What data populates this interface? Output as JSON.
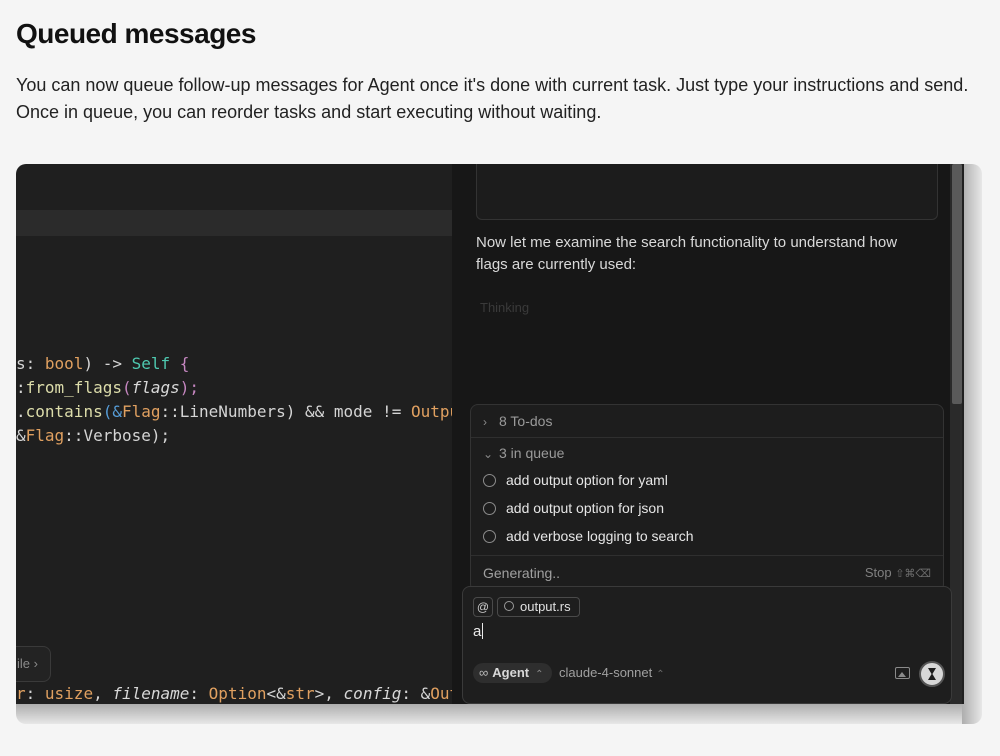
{
  "page": {
    "title": "Queued messages",
    "description": "You can now queue follow-up messages for Agent once it's done with current task. Just type your instructions and send. Once in queue, you can reorder tasks and start executing without waiting."
  },
  "editor": {
    "line1": [
      "s: ",
      "bool",
      ") -> ",
      "Self",
      " {"
    ],
    "line2": [
      ":",
      "from_flags",
      "(",
      "flags",
      ");"
    ],
    "line3": [
      ".",
      "contains",
      "(&",
      "Flag",
      "::LineNumbers) && mode != ",
      "Outpu"
    ],
    "line4": [
      "&",
      "Flag",
      "::Verbose);"
    ],
    "line5": [
      "r",
      ": ",
      "usize",
      ", ",
      "filename",
      ": ",
      "Option",
      "<&",
      "str",
      ">, ",
      "config",
      ": &",
      "Outpu"
    ],
    "file_pill": "ile"
  },
  "agent_panel": {
    "message": "Now let me examine the search functionality to understand how flags are currently used:",
    "faded": "Thinking"
  },
  "queue": {
    "todos_label": "8 To-dos",
    "queue_label": "3 in queue",
    "items": [
      "add output option for yaml",
      "add output option for json",
      "add verbose logging to search"
    ],
    "status": "Generating..",
    "stop_label": "Stop",
    "stop_shortcut": "⇧⌘⌫"
  },
  "input": {
    "at_symbol": "@",
    "context_file": "output.rs",
    "typed_text": "a",
    "mode_label": "Agent",
    "mode_icon": "∞",
    "model_label": "claude-4-sonnet"
  }
}
